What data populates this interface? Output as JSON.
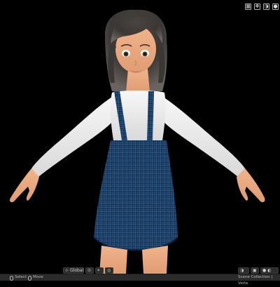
{
  "viewport": {
    "header": {
      "orientation_label": "Global",
      "pivot_icon": "pivot-icon",
      "snap_icon": "snap-icon",
      "proportional_icon": "proportional-edit-icon"
    },
    "top_icons": [
      "grid-icon",
      "gizmo-icon",
      "overlay-icon",
      "shading-icon"
    ],
    "background_color": "#000000"
  },
  "statusbar": {
    "select_label": "Select",
    "move_label": "Move",
    "collection_label": "Scene Collection | Verte"
  },
  "colors": {
    "shirt": "#efefef",
    "skirt": "#1f4a79",
    "hair": "#3b3734",
    "skin": "#e9ab83",
    "ui_bg": "#2b2b2b"
  }
}
